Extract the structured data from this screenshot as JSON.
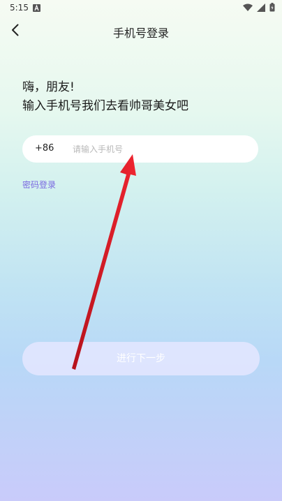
{
  "status_bar": {
    "time": "5:15",
    "notification_icon": "a-icon",
    "icons": [
      "wifi-icon",
      "cell-signal-icon",
      "battery-icon"
    ]
  },
  "header": {
    "title": "手机号登录",
    "back_icon": "chevron-left-icon"
  },
  "greeting": {
    "line1": "嗨，朋友!",
    "line2": "输入手机号我们去看帅哥美女吧"
  },
  "phone": {
    "country_code": "+86",
    "value": "",
    "placeholder": "请输入手机号"
  },
  "links": {
    "password_login": "密码登录"
  },
  "next_button": {
    "label": "进行下一步"
  },
  "annotation": {
    "arrow_color": "#e8232f"
  },
  "colors": {
    "link": "#7a68e0",
    "button_bg": "#e2e6ff"
  }
}
